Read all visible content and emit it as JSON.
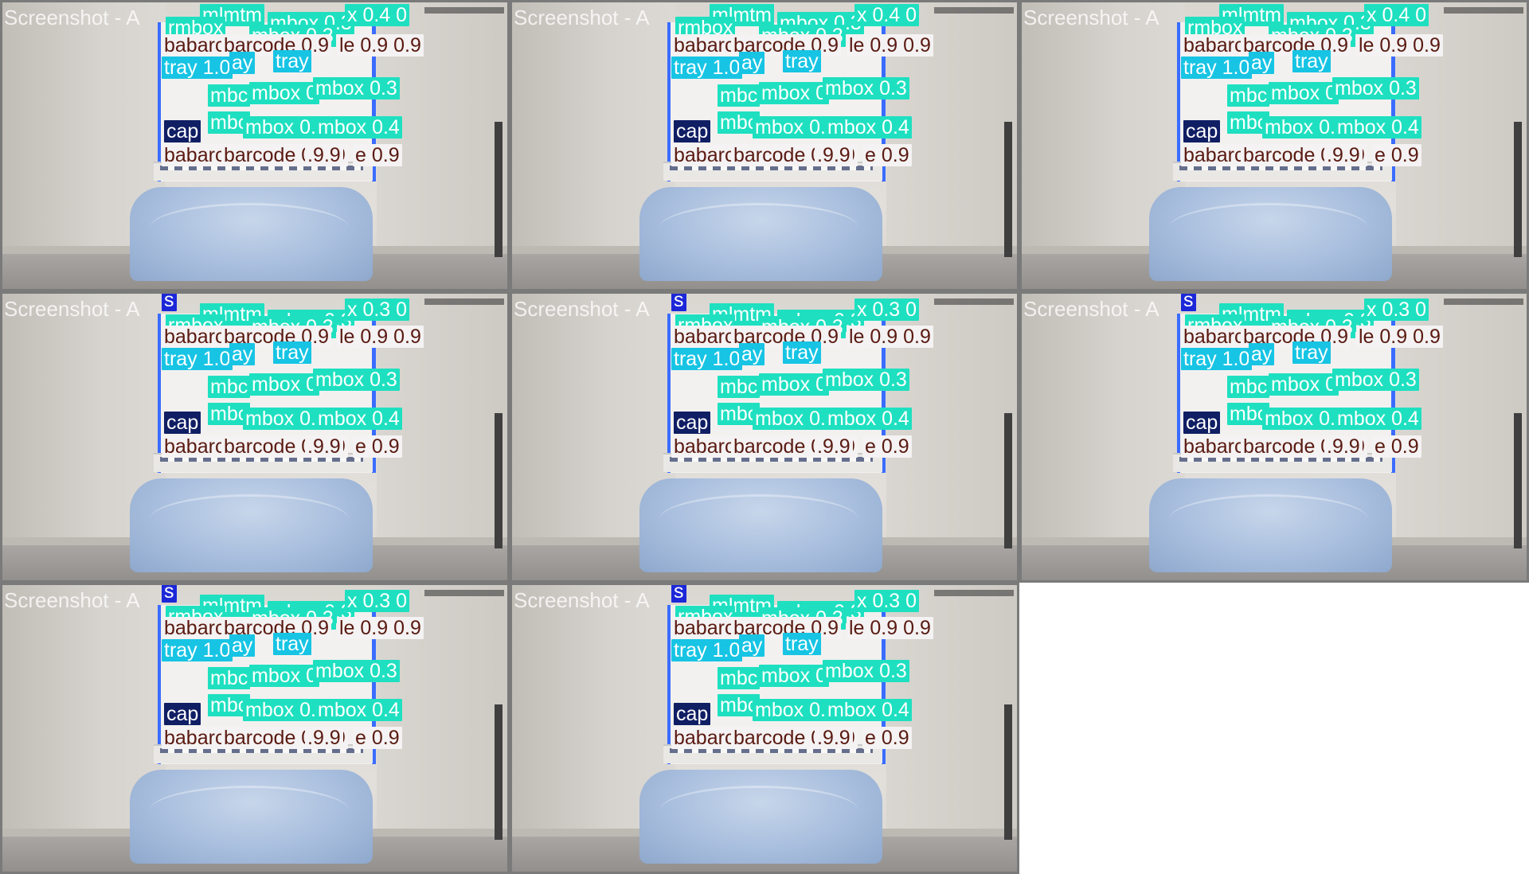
{
  "watermark": "Screenshot - A",
  "label_colors": {
    "mbox": "#1ee0c0",
    "barcode": "#f4f2f2",
    "barcode_text": "#5a1a12",
    "tray": "#17c4e4",
    "cap": "#101e64",
    "bar_marker": "#1c28d8"
  },
  "tiles": [
    {
      "labels": [
        {
          "text": "mlmtm",
          "cls": "mbox"
        },
        {
          "text": "mbox 0.3",
          "cls": "mbox"
        },
        {
          "text": "x 0.4 0",
          "cls": "mbox"
        },
        {
          "text": "rmbox",
          "cls": "mbox"
        },
        {
          "text": "mbox 0.3",
          "cls": "mbox"
        },
        {
          "text": "babarc",
          "cls": "barcode"
        },
        {
          "text": "barcode 0.9",
          "cls": "barcode"
        },
        {
          "text": "le 0.9 0.9",
          "cls": "barcode"
        },
        {
          "text": "tray 1.0",
          "cls": "tray"
        },
        {
          "text": "ay",
          "cls": "tray"
        },
        {
          "text": "tray",
          "cls": "tray"
        },
        {
          "text": "mbc",
          "cls": "mbox"
        },
        {
          "text": "mbox 0",
          "cls": "mbox"
        },
        {
          "text": "mbox 0.3",
          "cls": "mbox"
        },
        {
          "text": "cap",
          "cls": "cap"
        },
        {
          "text": "mbc",
          "cls": "mbox"
        },
        {
          "text": "mbox 0.",
          "cls": "mbox"
        },
        {
          "text": "mbox 0.4",
          "cls": "mbox"
        },
        {
          "text": "babarc",
          "cls": "barcode"
        },
        {
          "text": "barcode 0.9.9",
          "cls": "barcode"
        },
        {
          "text": ".9.9",
          "cls": "barcode"
        },
        {
          "text": "e 0.9",
          "cls": "barcode"
        }
      ]
    },
    {
      "labels": [
        {
          "text": "mlmtm",
          "cls": "mbox"
        },
        {
          "text": "mbox 0.3",
          "cls": "mbox"
        },
        {
          "text": "x 0.4 0",
          "cls": "mbox"
        },
        {
          "text": "rmbox",
          "cls": "mbox"
        },
        {
          "text": "mbox 0.3",
          "cls": "mbox"
        },
        {
          "text": "babarc",
          "cls": "barcode"
        },
        {
          "text": "barcode 0.9",
          "cls": "barcode"
        },
        {
          "text": "le 0.9 0.9",
          "cls": "barcode"
        },
        {
          "text": "tray 1.0",
          "cls": "tray"
        },
        {
          "text": "ay",
          "cls": "tray"
        },
        {
          "text": "tray",
          "cls": "tray"
        },
        {
          "text": "mbc",
          "cls": "mbox"
        },
        {
          "text": "mbox 0",
          "cls": "mbox"
        },
        {
          "text": "mbox 0.3",
          "cls": "mbox"
        },
        {
          "text": "cap",
          "cls": "cap"
        },
        {
          "text": "mbc",
          "cls": "mbox"
        },
        {
          "text": "mbox 0.",
          "cls": "mbox"
        },
        {
          "text": "mbox 0.4",
          "cls": "mbox"
        },
        {
          "text": "babarc",
          "cls": "barcode"
        },
        {
          "text": "barcode 0.9.9",
          "cls": "barcode"
        },
        {
          "text": ".9.9",
          "cls": "barcode"
        },
        {
          "text": "e 0.9",
          "cls": "barcode"
        }
      ]
    },
    {
      "labels": [
        {
          "text": "mlmtm",
          "cls": "mbox"
        },
        {
          "text": "mbox 0.3",
          "cls": "mbox"
        },
        {
          "text": "x 0.4 0",
          "cls": "mbox"
        },
        {
          "text": "rmbox",
          "cls": "mbox"
        },
        {
          "text": "mbox 0.3",
          "cls": "mbox"
        },
        {
          "text": "babarc",
          "cls": "barcode"
        },
        {
          "text": "barcode 0.9",
          "cls": "barcode"
        },
        {
          "text": "le 0.9 0.9",
          "cls": "barcode"
        },
        {
          "text": "tray 1.0",
          "cls": "tray"
        },
        {
          "text": "ay",
          "cls": "tray"
        },
        {
          "text": "tray",
          "cls": "tray"
        },
        {
          "text": "mbc",
          "cls": "mbox"
        },
        {
          "text": "mbox 0",
          "cls": "mbox"
        },
        {
          "text": "mbox 0.3",
          "cls": "mbox"
        },
        {
          "text": "cap",
          "cls": "cap"
        },
        {
          "text": "mbc",
          "cls": "mbox"
        },
        {
          "text": "mbox 0.",
          "cls": "mbox"
        },
        {
          "text": "mbox 0.4",
          "cls": "mbox"
        },
        {
          "text": "babarc",
          "cls": "barcode"
        },
        {
          "text": "barcode 0.9.9",
          "cls": "barcode"
        },
        {
          "text": ".9.9",
          "cls": "barcode"
        },
        {
          "text": "e 0.9",
          "cls": "barcode"
        }
      ]
    },
    {
      "labels": [
        {
          "text": "s",
          "cls": "mark"
        },
        {
          "text": "mlmtm",
          "cls": "mbox"
        },
        {
          "text": "mbox 0.3",
          "cls": "mbox"
        },
        {
          "text": "x 0.3 0",
          "cls": "mbox"
        },
        {
          "text": "rmbox",
          "cls": "mbox"
        },
        {
          "text": "mbox 0.3",
          "cls": "mbox"
        },
        {
          "text": "babarc",
          "cls": "barcode"
        },
        {
          "text": "barcode 0.9",
          "cls": "barcode"
        },
        {
          "text": "le 0.9 0.9",
          "cls": "barcode"
        },
        {
          "text": "tray 1.0",
          "cls": "tray"
        },
        {
          "text": "ay",
          "cls": "tray"
        },
        {
          "text": "tray",
          "cls": "tray"
        },
        {
          "text": "mbc",
          "cls": "mbox"
        },
        {
          "text": "mbox 0",
          "cls": "mbox"
        },
        {
          "text": "mbox 0.3",
          "cls": "mbox"
        },
        {
          "text": "cap",
          "cls": "cap"
        },
        {
          "text": "mbc",
          "cls": "mbox"
        },
        {
          "text": "mbox 0.",
          "cls": "mbox"
        },
        {
          "text": "mbox 0.4",
          "cls": "mbox"
        },
        {
          "text": "babarc",
          "cls": "barcode"
        },
        {
          "text": "barcode 0.9.9",
          "cls": "barcode"
        },
        {
          "text": ".9.9",
          "cls": "barcode"
        },
        {
          "text": "e 0.9",
          "cls": "barcode"
        }
      ]
    },
    {
      "labels": [
        {
          "text": "s",
          "cls": "mark"
        },
        {
          "text": "mlmtm",
          "cls": "mbox"
        },
        {
          "text": "mbox 0.3",
          "cls": "mbox"
        },
        {
          "text": "x 0.3 0",
          "cls": "mbox"
        },
        {
          "text": "rmbox",
          "cls": "mbox"
        },
        {
          "text": "mbox 0.3",
          "cls": "mbox"
        },
        {
          "text": "babarc",
          "cls": "barcode"
        },
        {
          "text": "barcode 0.9",
          "cls": "barcode"
        },
        {
          "text": "le 0.9 0.9",
          "cls": "barcode"
        },
        {
          "text": "tray 1.0",
          "cls": "tray"
        },
        {
          "text": "ay",
          "cls": "tray"
        },
        {
          "text": "tray",
          "cls": "tray"
        },
        {
          "text": "mbc",
          "cls": "mbox"
        },
        {
          "text": "mbox 0",
          "cls": "mbox"
        },
        {
          "text": "mbox 0.3",
          "cls": "mbox"
        },
        {
          "text": "cap",
          "cls": "cap"
        },
        {
          "text": "mbc",
          "cls": "mbox"
        },
        {
          "text": "mbox 0.",
          "cls": "mbox"
        },
        {
          "text": "mbox 0.4",
          "cls": "mbox"
        },
        {
          "text": "babarc",
          "cls": "barcode"
        },
        {
          "text": "barcode 0.9.9",
          "cls": "barcode"
        },
        {
          "text": ".9.9",
          "cls": "barcode"
        },
        {
          "text": "e 0.9",
          "cls": "barcode"
        }
      ]
    },
    {
      "labels": [
        {
          "text": "s",
          "cls": "mark"
        },
        {
          "text": "mlmtm",
          "cls": "mbox"
        },
        {
          "text": "mbox 0.3",
          "cls": "mbox"
        },
        {
          "text": "x 0.3 0",
          "cls": "mbox"
        },
        {
          "text": "rmbox",
          "cls": "mbox"
        },
        {
          "text": "mbox 0.3",
          "cls": "mbox"
        },
        {
          "text": "babarc",
          "cls": "barcode"
        },
        {
          "text": "barcode 0.9",
          "cls": "barcode"
        },
        {
          "text": "le 0.9 0.9",
          "cls": "barcode"
        },
        {
          "text": "tray 1.0",
          "cls": "tray"
        },
        {
          "text": "ay",
          "cls": "tray"
        },
        {
          "text": "tray",
          "cls": "tray"
        },
        {
          "text": "mbc",
          "cls": "mbox"
        },
        {
          "text": "mbox 0",
          "cls": "mbox"
        },
        {
          "text": "mbox 0.3",
          "cls": "mbox"
        },
        {
          "text": "cap",
          "cls": "cap"
        },
        {
          "text": "mbc",
          "cls": "mbox"
        },
        {
          "text": "mbox 0.",
          "cls": "mbox"
        },
        {
          "text": "mbox 0.4",
          "cls": "mbox"
        },
        {
          "text": "babarc",
          "cls": "barcode"
        },
        {
          "text": "barcode 0.9.9",
          "cls": "barcode"
        },
        {
          "text": ".9.9",
          "cls": "barcode"
        },
        {
          "text": "e 0.9",
          "cls": "barcode"
        }
      ]
    },
    {
      "labels": [
        {
          "text": "s",
          "cls": "mark"
        },
        {
          "text": "mlmtm",
          "cls": "mbox"
        },
        {
          "text": "mbox 0.3",
          "cls": "mbox"
        },
        {
          "text": "x 0.3 0",
          "cls": "mbox"
        },
        {
          "text": "rmbox",
          "cls": "mbox"
        },
        {
          "text": "mbox 0.3",
          "cls": "mbox"
        },
        {
          "text": "babarc",
          "cls": "barcode"
        },
        {
          "text": "barcode 0.9",
          "cls": "barcode"
        },
        {
          "text": "le 0.9 0.9",
          "cls": "barcode"
        },
        {
          "text": "tray 1.0",
          "cls": "tray"
        },
        {
          "text": "ay",
          "cls": "tray"
        },
        {
          "text": "tray",
          "cls": "tray"
        },
        {
          "text": "mbc",
          "cls": "mbox"
        },
        {
          "text": "mbox 0",
          "cls": "mbox"
        },
        {
          "text": "mbox 0.3",
          "cls": "mbox"
        },
        {
          "text": "cap",
          "cls": "cap"
        },
        {
          "text": "mbc",
          "cls": "mbox"
        },
        {
          "text": "mbox 0.",
          "cls": "mbox"
        },
        {
          "text": "mbox 0.4",
          "cls": "mbox"
        },
        {
          "text": "babarc",
          "cls": "barcode"
        },
        {
          "text": "barcode 0.9.9",
          "cls": "barcode"
        },
        {
          "text": ".9.9",
          "cls": "barcode"
        },
        {
          "text": "e 0.9",
          "cls": "barcode"
        }
      ]
    },
    {
      "labels": [
        {
          "text": "s",
          "cls": "mark"
        },
        {
          "text": "mlmtm",
          "cls": "mbox"
        },
        {
          "text": "mbox 0.3",
          "cls": "mbox"
        },
        {
          "text": "x 0.3 0",
          "cls": "mbox"
        },
        {
          "text": "rmbox",
          "cls": "mbox"
        },
        {
          "text": "mbox 0.3",
          "cls": "mbox"
        },
        {
          "text": "babarc",
          "cls": "barcode"
        },
        {
          "text": "barcode 0.9",
          "cls": "barcode"
        },
        {
          "text": "le 0.9 0.9",
          "cls": "barcode"
        },
        {
          "text": "tray 1.0",
          "cls": "tray"
        },
        {
          "text": "ay",
          "cls": "tray"
        },
        {
          "text": "tray",
          "cls": "tray"
        },
        {
          "text": "mbc",
          "cls": "mbox"
        },
        {
          "text": "mbox 0",
          "cls": "mbox"
        },
        {
          "text": "mbox 0.3",
          "cls": "mbox"
        },
        {
          "text": "cap",
          "cls": "cap"
        },
        {
          "text": "mbc",
          "cls": "mbox"
        },
        {
          "text": "mbox 0.",
          "cls": "mbox"
        },
        {
          "text": "mbox 0.4",
          "cls": "mbox"
        },
        {
          "text": "babarc",
          "cls": "barcode"
        },
        {
          "text": "barcode 0.9.9",
          "cls": "barcode"
        },
        {
          "text": ".9.9",
          "cls": "barcode"
        },
        {
          "text": "e 0.9",
          "cls": "barcode"
        }
      ]
    }
  ]
}
